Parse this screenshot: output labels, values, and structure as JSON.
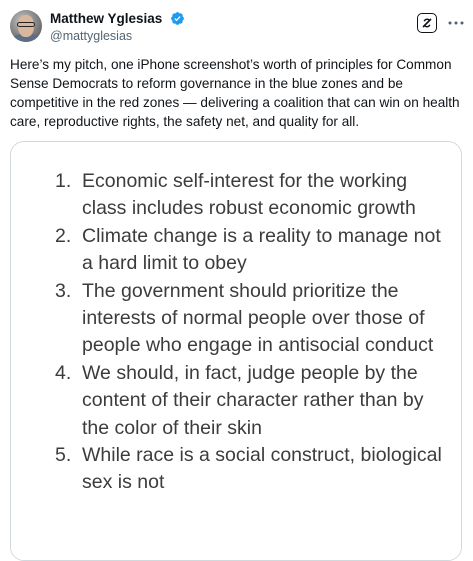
{
  "author": {
    "display_name": "Matthew Yglesias",
    "handle": "@mattyglesias",
    "verified": true,
    "verified_color": "#1d9bf0"
  },
  "actions": {
    "grok_icon": "grok-icon",
    "more_icon": "more-icon"
  },
  "tweet": {
    "text": "Here’s my pitch, one iPhone screenshot’s worth of principles for Common Sense Democrats to reform governance in the blue zones and be competitive in the red zones — delivering a coalition that can win on health care, reproductive rights, the safety net, and quality for all."
  },
  "media": {
    "principles": [
      {
        "number": "1.",
        "text": "Economic self-interest for the working class includes robust economic growth"
      },
      {
        "number": "2.",
        "text": "Climate change is a reality to manage not a hard limit to obey"
      },
      {
        "number": "3.",
        "text": "The government should prioritize the interests of normal people over those of people who engage in antisocial conduct"
      },
      {
        "number": "4.",
        "text": "We should, in fact, judge people by the content of their character rather than by the color of their skin"
      },
      {
        "number": "5.",
        "text": "While race is a social construct, biological sex is not"
      }
    ]
  }
}
